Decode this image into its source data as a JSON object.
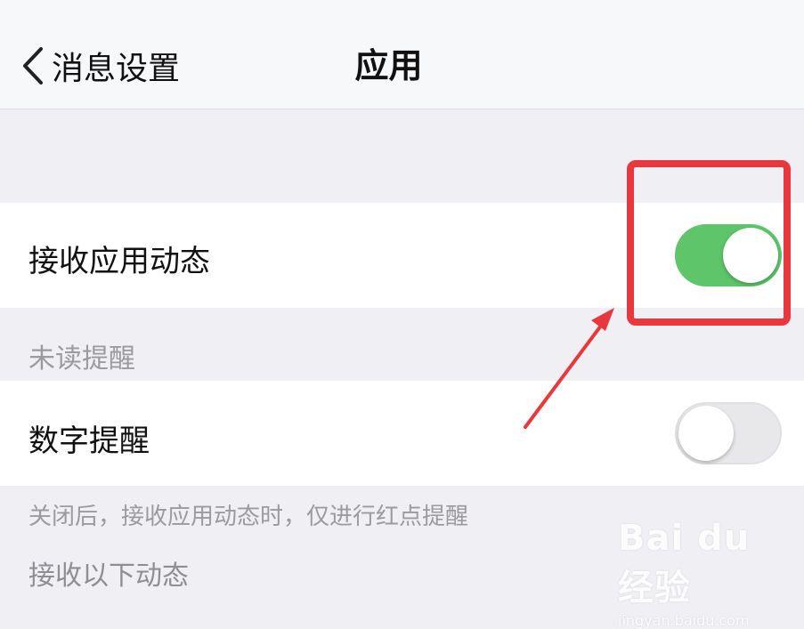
{
  "nav": {
    "back_label": "消息设置",
    "title": "应用"
  },
  "settings": {
    "receive_app_updates": {
      "label": "接收应用动态",
      "enabled": true
    },
    "unread_section_label": "未读提醒",
    "number_badge": {
      "label": "数字提醒",
      "enabled": false
    },
    "hint": "关闭后，接收应用动态时，仅进行红点提醒",
    "receive_following_label": "接收以下动态"
  },
  "colors": {
    "toggle_on": "#5ec56a",
    "toggle_off": "#e8e8ea",
    "highlight": "#e8383d"
  },
  "watermark": {
    "logo": "Bai du 经验",
    "url": "jingyan.baidu.com"
  }
}
